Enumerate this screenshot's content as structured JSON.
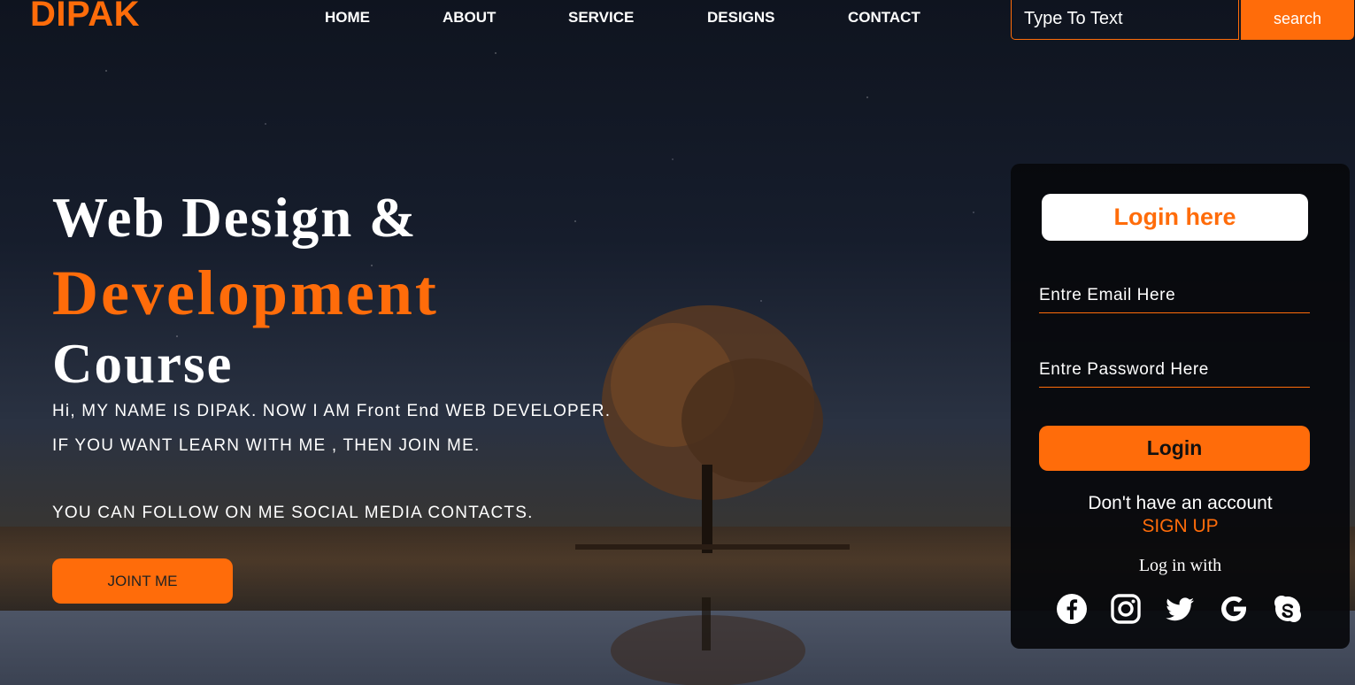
{
  "brand": {
    "logo": "DIPAK"
  },
  "nav": {
    "items": [
      {
        "label": "HOME"
      },
      {
        "label": "ABOUT"
      },
      {
        "label": "SERVICE"
      },
      {
        "label": "DESIGNS"
      },
      {
        "label": "CONTACT"
      }
    ]
  },
  "search": {
    "placeholder": "Type To Text",
    "button_label": "search"
  },
  "hero": {
    "line1": "Web Design &",
    "line2": "Development",
    "line3": "Course",
    "para1": "Hi, MY NAME IS DIPAK. NOW I AM Front End WEB DEVELOPER.",
    "para2": "IF YOU WANT LEARN WITH ME , THEN JOIN ME.",
    "para3": "YOU CAN FOLLOW ON ME SOCIAL MEDIA CONTACTS.",
    "cta_label": "JOINT ME"
  },
  "login": {
    "title": "Login here",
    "email_placeholder": "Entre Email Here",
    "password_placeholder": "Entre Password Here",
    "button_label": "Login",
    "no_account_text": "Don't have an account",
    "signup_label": "SIGN UP",
    "login_with_text": "Log in with",
    "social_icons": [
      "facebook-icon",
      "instagram-icon",
      "twitter-icon",
      "google-icon",
      "skype-icon"
    ]
  },
  "colors": {
    "accent": "#ff6c0a",
    "card_bg": "#08090c",
    "text": "#ffffff"
  }
}
